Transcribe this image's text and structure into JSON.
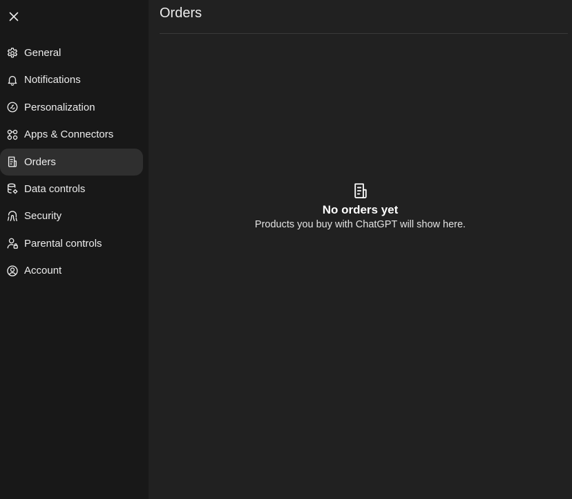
{
  "sidebar": {
    "close_icon": "close-icon",
    "items": [
      {
        "label": "General",
        "icon": "gear-icon",
        "active": false
      },
      {
        "label": "Notifications",
        "icon": "bell-icon",
        "active": false
      },
      {
        "label": "Personalization",
        "icon": "personalization-icon",
        "active": false
      },
      {
        "label": "Apps & Connectors",
        "icon": "apps-icon",
        "active": false
      },
      {
        "label": "Orders",
        "icon": "receipt-icon",
        "active": true
      },
      {
        "label": "Data controls",
        "icon": "database-gear-icon",
        "active": false
      },
      {
        "label": "Security",
        "icon": "fingerprint-icon",
        "active": false
      },
      {
        "label": "Parental controls",
        "icon": "parental-user-icon",
        "active": false
      },
      {
        "label": "Account",
        "icon": "account-circle-icon",
        "active": false
      }
    ]
  },
  "main": {
    "title": "Orders",
    "empty_state": {
      "icon": "receipt-icon",
      "title": "No orders yet",
      "subtitle": "Products you buy with ChatGPT will show here."
    }
  },
  "colors": {
    "background": "#212121",
    "sidebar": "#181818",
    "active_item": "#2f2f2f",
    "text": "#ececec"
  }
}
